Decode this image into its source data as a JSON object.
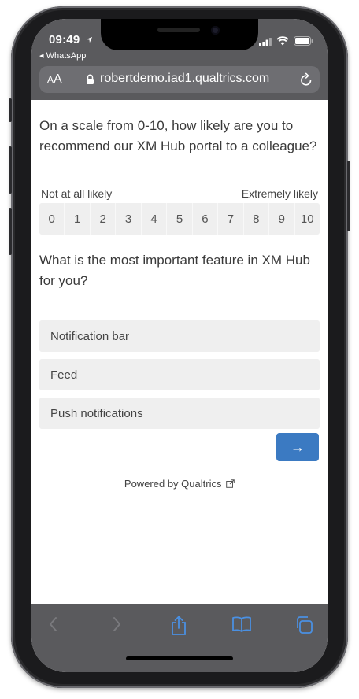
{
  "status_bar": {
    "time": "09:49",
    "back_app": "◂ WhatsApp"
  },
  "browser": {
    "text_size_label_small": "A",
    "text_size_label_large": "A",
    "url": "robertdemo.iad1.qualtrics.com"
  },
  "survey": {
    "question1": "On a scale from 0-10, how likely are you to recommend our XM Hub portal to a colleague?",
    "scale_label_low": "Not at all likely",
    "scale_label_high": "Extremely likely",
    "scale": [
      "0",
      "1",
      "2",
      "3",
      "4",
      "5",
      "6",
      "7",
      "8",
      "9",
      "10"
    ],
    "question2": "What is the most important feature in XM Hub for you?",
    "choices": [
      "Notification bar",
      "Feed",
      "Push notifications"
    ],
    "next_label": "→",
    "powered_by": "Powered by Qualtrics"
  },
  "colors": {
    "accent": "#3b7ac2",
    "chrome": "#5a5a5d",
    "option_bg": "#efefef",
    "toolbar_active": "#4a90e2"
  },
  "icons": {
    "status": [
      "location-arrow-icon",
      "signal-icon",
      "wifi-icon",
      "battery-icon"
    ],
    "browser": [
      "lock-icon",
      "reload-icon"
    ],
    "toolbar": [
      "back-arrow-icon",
      "forward-arrow-icon",
      "share-icon",
      "bookmarks-icon",
      "tabs-icon"
    ],
    "footer": [
      "external-link-icon"
    ]
  }
}
